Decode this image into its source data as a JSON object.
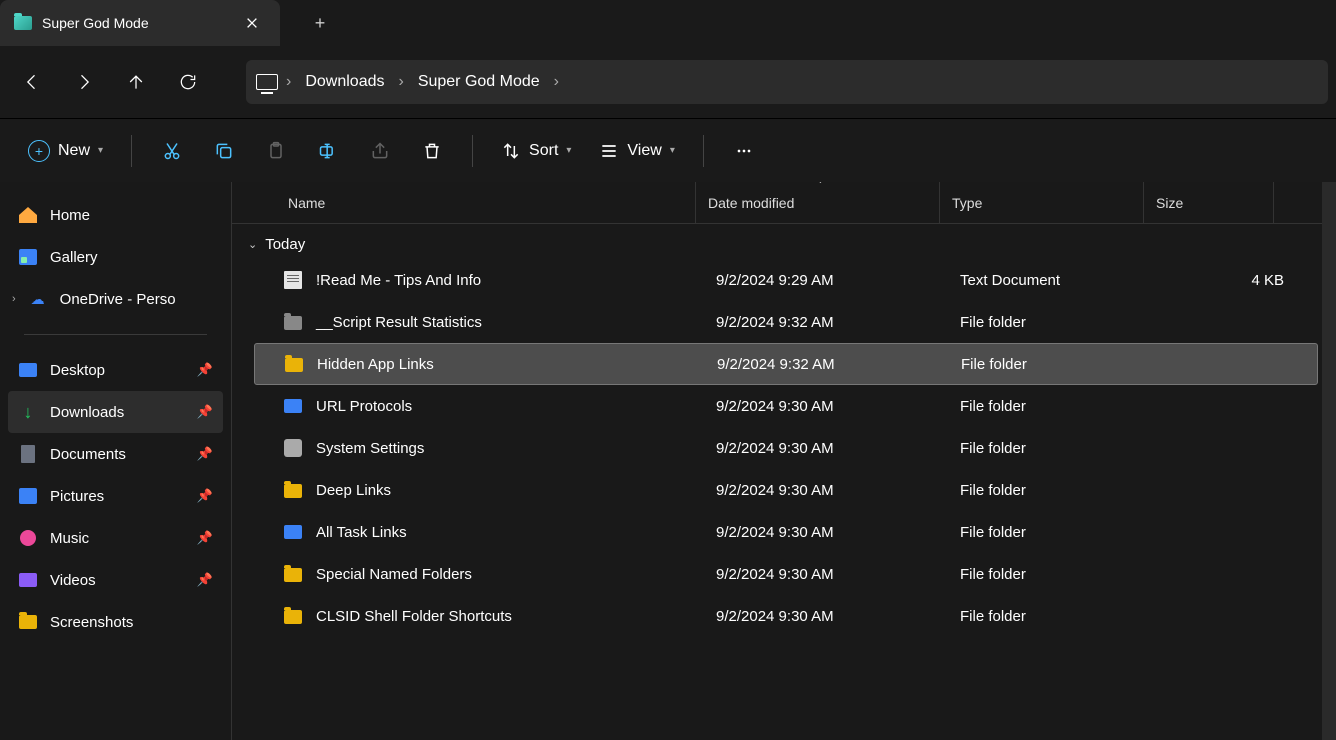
{
  "tab": {
    "title": "Super God Mode"
  },
  "breadcrumbs": [
    "Downloads",
    "Super God Mode"
  ],
  "toolbar": {
    "new": "New",
    "sort": "Sort",
    "view": "View"
  },
  "sidebar": {
    "top": [
      {
        "label": "Home",
        "icon": "home"
      },
      {
        "label": "Gallery",
        "icon": "gallery"
      },
      {
        "label": "OneDrive - Perso",
        "icon": "cloud",
        "expandable": true
      }
    ],
    "pinned": [
      {
        "label": "Desktop",
        "icon": "desktop"
      },
      {
        "label": "Downloads",
        "icon": "down",
        "active": true
      },
      {
        "label": "Documents",
        "icon": "doc"
      },
      {
        "label": "Pictures",
        "icon": "pic"
      },
      {
        "label": "Music",
        "icon": "music"
      },
      {
        "label": "Videos",
        "icon": "video"
      },
      {
        "label": "Screenshots",
        "icon": "folder-y"
      }
    ]
  },
  "columns": {
    "name": "Name",
    "date": "Date modified",
    "type": "Type",
    "size": "Size"
  },
  "group": "Today",
  "files": [
    {
      "name": "!Read Me - Tips And Info",
      "date": "9/2/2024 9:29 AM",
      "type": "Text Document",
      "size": "4 KB",
      "icon": "txt"
    },
    {
      "name": "__Script Result Statistics",
      "date": "9/2/2024 9:32 AM",
      "type": "File folder",
      "size": "",
      "icon": "folder"
    },
    {
      "name": "Hidden App Links",
      "date": "9/2/2024 9:32 AM",
      "type": "File folder",
      "size": "",
      "icon": "folder-y",
      "selected": true
    },
    {
      "name": "URL Protocols",
      "date": "9/2/2024 9:30 AM",
      "type": "File folder",
      "size": "",
      "icon": "folder-b"
    },
    {
      "name": "System Settings",
      "date": "9/2/2024 9:30 AM",
      "type": "File folder",
      "size": "",
      "icon": "gear"
    },
    {
      "name": "Deep Links",
      "date": "9/2/2024 9:30 AM",
      "type": "File folder",
      "size": "",
      "icon": "folder-y"
    },
    {
      "name": "All Task Links",
      "date": "9/2/2024 9:30 AM",
      "type": "File folder",
      "size": "",
      "icon": "folder-b"
    },
    {
      "name": "Special Named Folders",
      "date": "9/2/2024 9:30 AM",
      "type": "File folder",
      "size": "",
      "icon": "folder-y"
    },
    {
      "name": "CLSID Shell Folder Shortcuts",
      "date": "9/2/2024 9:30 AM",
      "type": "File folder",
      "size": "",
      "icon": "folder-y"
    }
  ]
}
